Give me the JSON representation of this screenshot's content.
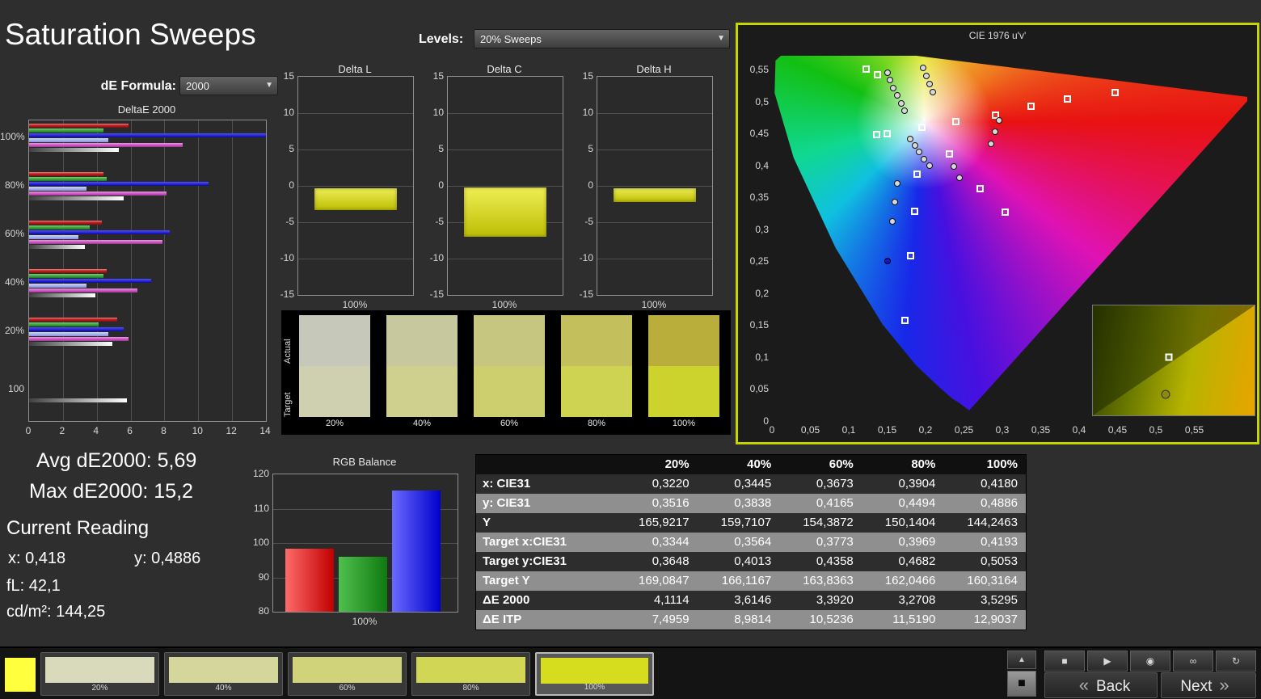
{
  "header": {
    "title": "Saturation Sweeps",
    "de_formula_label": "dE Formula:",
    "de_formula_value": "2000",
    "levels_label": "Levels:",
    "levels_value": "20% Sweeps"
  },
  "deltae_chart": {
    "type": "bar-horizontal",
    "title": "DeltaE 2000",
    "x_ticks": [
      "0",
      "2",
      "4",
      "6",
      "8",
      "10",
      "12",
      "14"
    ],
    "x_max": 14,
    "groups": [
      {
        "label": "100%",
        "bars": [
          {
            "color": "red",
            "value": 5.9
          },
          {
            "color": "green",
            "value": 4.4
          },
          {
            "color": "navy",
            "value": 14.6
          },
          {
            "color": "sky",
            "value": 4.7
          },
          {
            "color": "magenta",
            "value": 9.1
          },
          {
            "color": "gray",
            "value": 5.3
          }
        ]
      },
      {
        "label": "80%",
        "bars": [
          {
            "color": "red",
            "value": 4.4
          },
          {
            "color": "green",
            "value": 4.6
          },
          {
            "color": "navy",
            "value": 10.6
          },
          {
            "color": "sky",
            "value": 3.4
          },
          {
            "color": "magenta",
            "value": 8.1
          },
          {
            "color": "gray",
            "value": 5.6
          }
        ]
      },
      {
        "label": "60%",
        "bars": [
          {
            "color": "red",
            "value": 4.3
          },
          {
            "color": "green",
            "value": 3.6
          },
          {
            "color": "navy",
            "value": 8.3
          },
          {
            "color": "sky",
            "value": 2.9
          },
          {
            "color": "magenta",
            "value": 7.9
          },
          {
            "color": "gray",
            "value": 3.3
          }
        ]
      },
      {
        "label": "40%",
        "bars": [
          {
            "color": "red",
            "value": 4.6
          },
          {
            "color": "green",
            "value": 4.4
          },
          {
            "color": "navy",
            "value": 7.2
          },
          {
            "color": "sky",
            "value": 3.4
          },
          {
            "color": "magenta",
            "value": 6.4
          },
          {
            "color": "gray",
            "value": 3.9
          }
        ]
      },
      {
        "label": "20%",
        "bars": [
          {
            "color": "red",
            "value": 5.2
          },
          {
            "color": "green",
            "value": 4.1
          },
          {
            "color": "navy",
            "value": 5.6
          },
          {
            "color": "sky",
            "value": 4.7
          },
          {
            "color": "magenta",
            "value": 5.9
          },
          {
            "color": "gray",
            "value": 4.9
          }
        ]
      },
      {
        "label": "100",
        "bars": [
          {
            "color": "gray",
            "value": 5.8
          }
        ]
      }
    ]
  },
  "mini_charts": {
    "y_ticks": [
      "15",
      "10",
      "5",
      "0",
      "-5",
      "-10",
      "-15"
    ],
    "charts": [
      {
        "title": "Delta L",
        "x_label": "100%",
        "bar_from": -0.3,
        "bar_to": -3.3
      },
      {
        "title": "Delta C",
        "x_label": "100%",
        "bar_from": -0.2,
        "bar_to": -7.0
      },
      {
        "title": "Delta H",
        "x_label": "100%",
        "bar_from": -0.3,
        "bar_to": -2.2
      }
    ]
  },
  "swatch_strip": {
    "row_labels": [
      "Actual",
      "Target"
    ],
    "items": [
      {
        "label": "20%",
        "actual": "#c6c8b9",
        "target": "#cfd0af"
      },
      {
        "label": "40%",
        "actual": "#c7c89e",
        "target": "#cfd08d"
      },
      {
        "label": "60%",
        "actual": "#c6c681",
        "target": "#cdcf6e"
      },
      {
        "label": "80%",
        "actual": "#c2bf5c",
        "target": "#ced351"
      },
      {
        "label": "100%",
        "actual": "#b9ae3c",
        "target": "#ccd32c"
      }
    ]
  },
  "cie": {
    "title": "CIE 1976 u'v'",
    "axis_labels": [
      "0",
      "0,05",
      "0,1",
      "0,15",
      "0,2",
      "0,25",
      "0,3",
      "0,35",
      "0,4",
      "0,45",
      "0,5",
      "0,55"
    ],
    "locus": [
      [
        0.2568,
        0.0166
      ],
      [
        0.2443,
        0.028
      ],
      [
        0.2347,
        0.035
      ],
      [
        0.2161,
        0.0549
      ],
      [
        0.1877,
        0.0871
      ],
      [
        0.1441,
        0.151
      ],
      [
        0.0828,
        0.2708
      ],
      [
        0.0282,
        0.4117
      ],
      [
        0.0035,
        0.5131
      ],
      [
        0.0046,
        0.5639
      ],
      [
        0.0231,
        0.5837
      ],
      [
        0.0501,
        0.5868
      ],
      [
        0.0792,
        0.5856
      ],
      [
        0.1127,
        0.5821
      ],
      [
        0.1531,
        0.5766
      ],
      [
        0.2026,
        0.5693
      ],
      [
        0.2623,
        0.5604
      ],
      [
        0.3315,
        0.5501
      ],
      [
        0.4035,
        0.5393
      ],
      [
        0.4692,
        0.5296
      ],
      [
        0.5203,
        0.5219
      ],
      [
        0.6005,
        0.5099
      ],
      [
        0.6234,
        0.5065
      ]
    ],
    "targets": [
      [
        0.123,
        0.55
      ],
      [
        0.138,
        0.541
      ],
      [
        0.151,
        0.449
      ],
      [
        0.137,
        0.447
      ],
      [
        0.196,
        0.459
      ],
      [
        0.24,
        0.468
      ],
      [
        0.292,
        0.478
      ],
      [
        0.338,
        0.492
      ],
      [
        0.385,
        0.503
      ],
      [
        0.447,
        0.513
      ],
      [
        0.232,
        0.417
      ],
      [
        0.189,
        0.385
      ],
      [
        0.272,
        0.363
      ],
      [
        0.304,
        0.326
      ],
      [
        0.186,
        0.327
      ],
      [
        0.181,
        0.258
      ],
      [
        0.174,
        0.157
      ]
    ],
    "measurements": [
      [
        0.15,
        0.545
      ],
      [
        0.154,
        0.533
      ],
      [
        0.158,
        0.521
      ],
      [
        0.163,
        0.509
      ],
      [
        0.168,
        0.497
      ],
      [
        0.173,
        0.486
      ],
      [
        0.197,
        0.552
      ],
      [
        0.201,
        0.54
      ],
      [
        0.205,
        0.527
      ],
      [
        0.209,
        0.514
      ],
      [
        0.296,
        0.47
      ],
      [
        0.291,
        0.452
      ],
      [
        0.285,
        0.434
      ],
      [
        0.18,
        0.441
      ],
      [
        0.186,
        0.431
      ],
      [
        0.192,
        0.421
      ],
      [
        0.198,
        0.41
      ],
      [
        0.205,
        0.4
      ],
      [
        0.237,
        0.398
      ],
      [
        0.244,
        0.381
      ],
      [
        0.163,
        0.372
      ],
      [
        0.16,
        0.342
      ],
      [
        0.157,
        0.312
      ]
    ],
    "blue_point": [
      0.15,
      0.25
    ],
    "inset": {
      "square_x": 47,
      "square_y": 47,
      "circle_x": 45,
      "circle_y": 81
    }
  },
  "stats": {
    "avg": "Avg dE2000: 5,69",
    "max": "Max dE2000: 15,2",
    "current_reading": "Current Reading",
    "x": "x: 0,418",
    "y": "y: 0,4886",
    "fl": "fL: 42,1",
    "cdm2": "cd/m²: 144,25"
  },
  "rgb_chart": {
    "type": "bar",
    "title": "RGB Balance",
    "y_ticks": [
      "120",
      "110",
      "100",
      "90",
      "80"
    ],
    "y_min": 80,
    "y_max": 120,
    "x_label": "100%",
    "bars": [
      {
        "color": "red",
        "value": 98.3
      },
      {
        "color": "green",
        "value": 96.0
      },
      {
        "color": "blue",
        "value": 115.2
      }
    ]
  },
  "table": {
    "columns": [
      "",
      "20%",
      "40%",
      "60%",
      "80%",
      "100%"
    ],
    "rows": [
      {
        "label": "x: CIE31",
        "values": [
          "0,3220",
          "0,3445",
          "0,3673",
          "0,3904",
          "0,4180"
        ]
      },
      {
        "label": "y: CIE31",
        "values": [
          "0,3516",
          "0,3838",
          "0,4165",
          "0,4494",
          "0,4886"
        ]
      },
      {
        "label": "Y",
        "values": [
          "165,9217",
          "159,7107",
          "154,3872",
          "150,1404",
          "144,2463"
        ]
      },
      {
        "label": "Target x:CIE31",
        "values": [
          "0,3344",
          "0,3564",
          "0,3773",
          "0,3969",
          "0,4193"
        ]
      },
      {
        "label": "Target y:CIE31",
        "values": [
          "0,3648",
          "0,4013",
          "0,4358",
          "0,4682",
          "0,5053"
        ]
      },
      {
        "label": "Target Y",
        "values": [
          "169,0847",
          "166,1167",
          "163,8363",
          "162,0466",
          "160,3164"
        ]
      },
      {
        "label": "ΔE 2000",
        "values": [
          "4,1114",
          "3,6146",
          "3,3920",
          "3,2708",
          "3,5295"
        ]
      },
      {
        "label": "ΔE ITP",
        "values": [
          "7,4959",
          "8,9814",
          "10,5236",
          "11,5190",
          "12,9037"
        ]
      }
    ]
  },
  "bottom_bar": {
    "current_patch_color": "#ffff3d",
    "patches": [
      {
        "label": "20%",
        "color": "#d9dabc"
      },
      {
        "label": "40%",
        "color": "#d5d69c"
      },
      {
        "label": "60%",
        "color": "#d1d37b"
      },
      {
        "label": "80%",
        "color": "#d2d655"
      },
      {
        "label": "100%",
        "color": "#d6dc1e"
      }
    ],
    "selected_patch": 4,
    "transport": [
      {
        "name": "stop",
        "glyph": "■"
      },
      {
        "name": "play",
        "glyph": "▶"
      },
      {
        "name": "record",
        "glyph": "◉"
      },
      {
        "name": "loop",
        "glyph": "∞"
      },
      {
        "name": "refresh",
        "glyph": "↻"
      }
    ],
    "collapse_glyph": "▲",
    "big_stop_glyph": "■",
    "back_label": "Back",
    "next_label": "Next",
    "back_chevron": "«",
    "next_chevron": "»"
  }
}
